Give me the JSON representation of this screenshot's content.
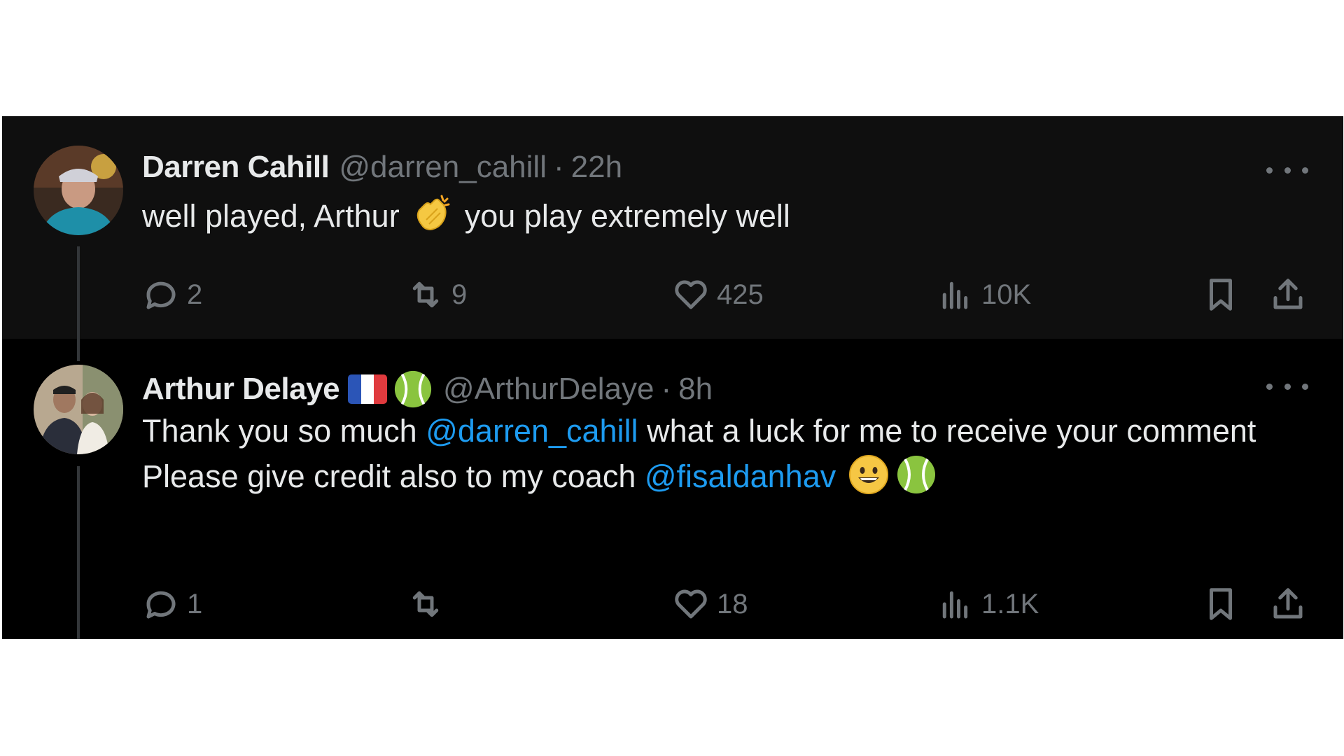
{
  "thread": [
    {
      "author": "Darren Cahill",
      "handle": "@darren_cahill",
      "separator": "·",
      "time": "22h",
      "text_before": "well played, Arthur",
      "text_after": "you play extremely well",
      "emoji": "clapping-hands",
      "actions": {
        "replies": "2",
        "reposts": "9",
        "likes": "425",
        "views": "10K"
      }
    },
    {
      "author": "Arthur Delaye",
      "handle": "@ArthurDelaye",
      "separator": "·",
      "time": "8h",
      "badges": [
        "france-flag",
        "tennis-ball"
      ],
      "line1_before": "Thank you so much",
      "mention1": "@darren_cahill",
      "line1_after": "what a luck for me to receive your comment",
      "line2_before": "Please give credit also to my coach",
      "mention2": "@fisaldanhav",
      "line2_emojis": [
        "grinning-face",
        "tennis-ball"
      ],
      "actions": {
        "replies": "1",
        "reposts": "",
        "likes": "18",
        "views": "1.1K"
      }
    }
  ],
  "colors": {
    "background": "#000000",
    "highlight_background": "#0f0f0f",
    "text_primary": "#e7e9ea",
    "text_secondary": "#71767b",
    "link": "#1d9bf0"
  }
}
